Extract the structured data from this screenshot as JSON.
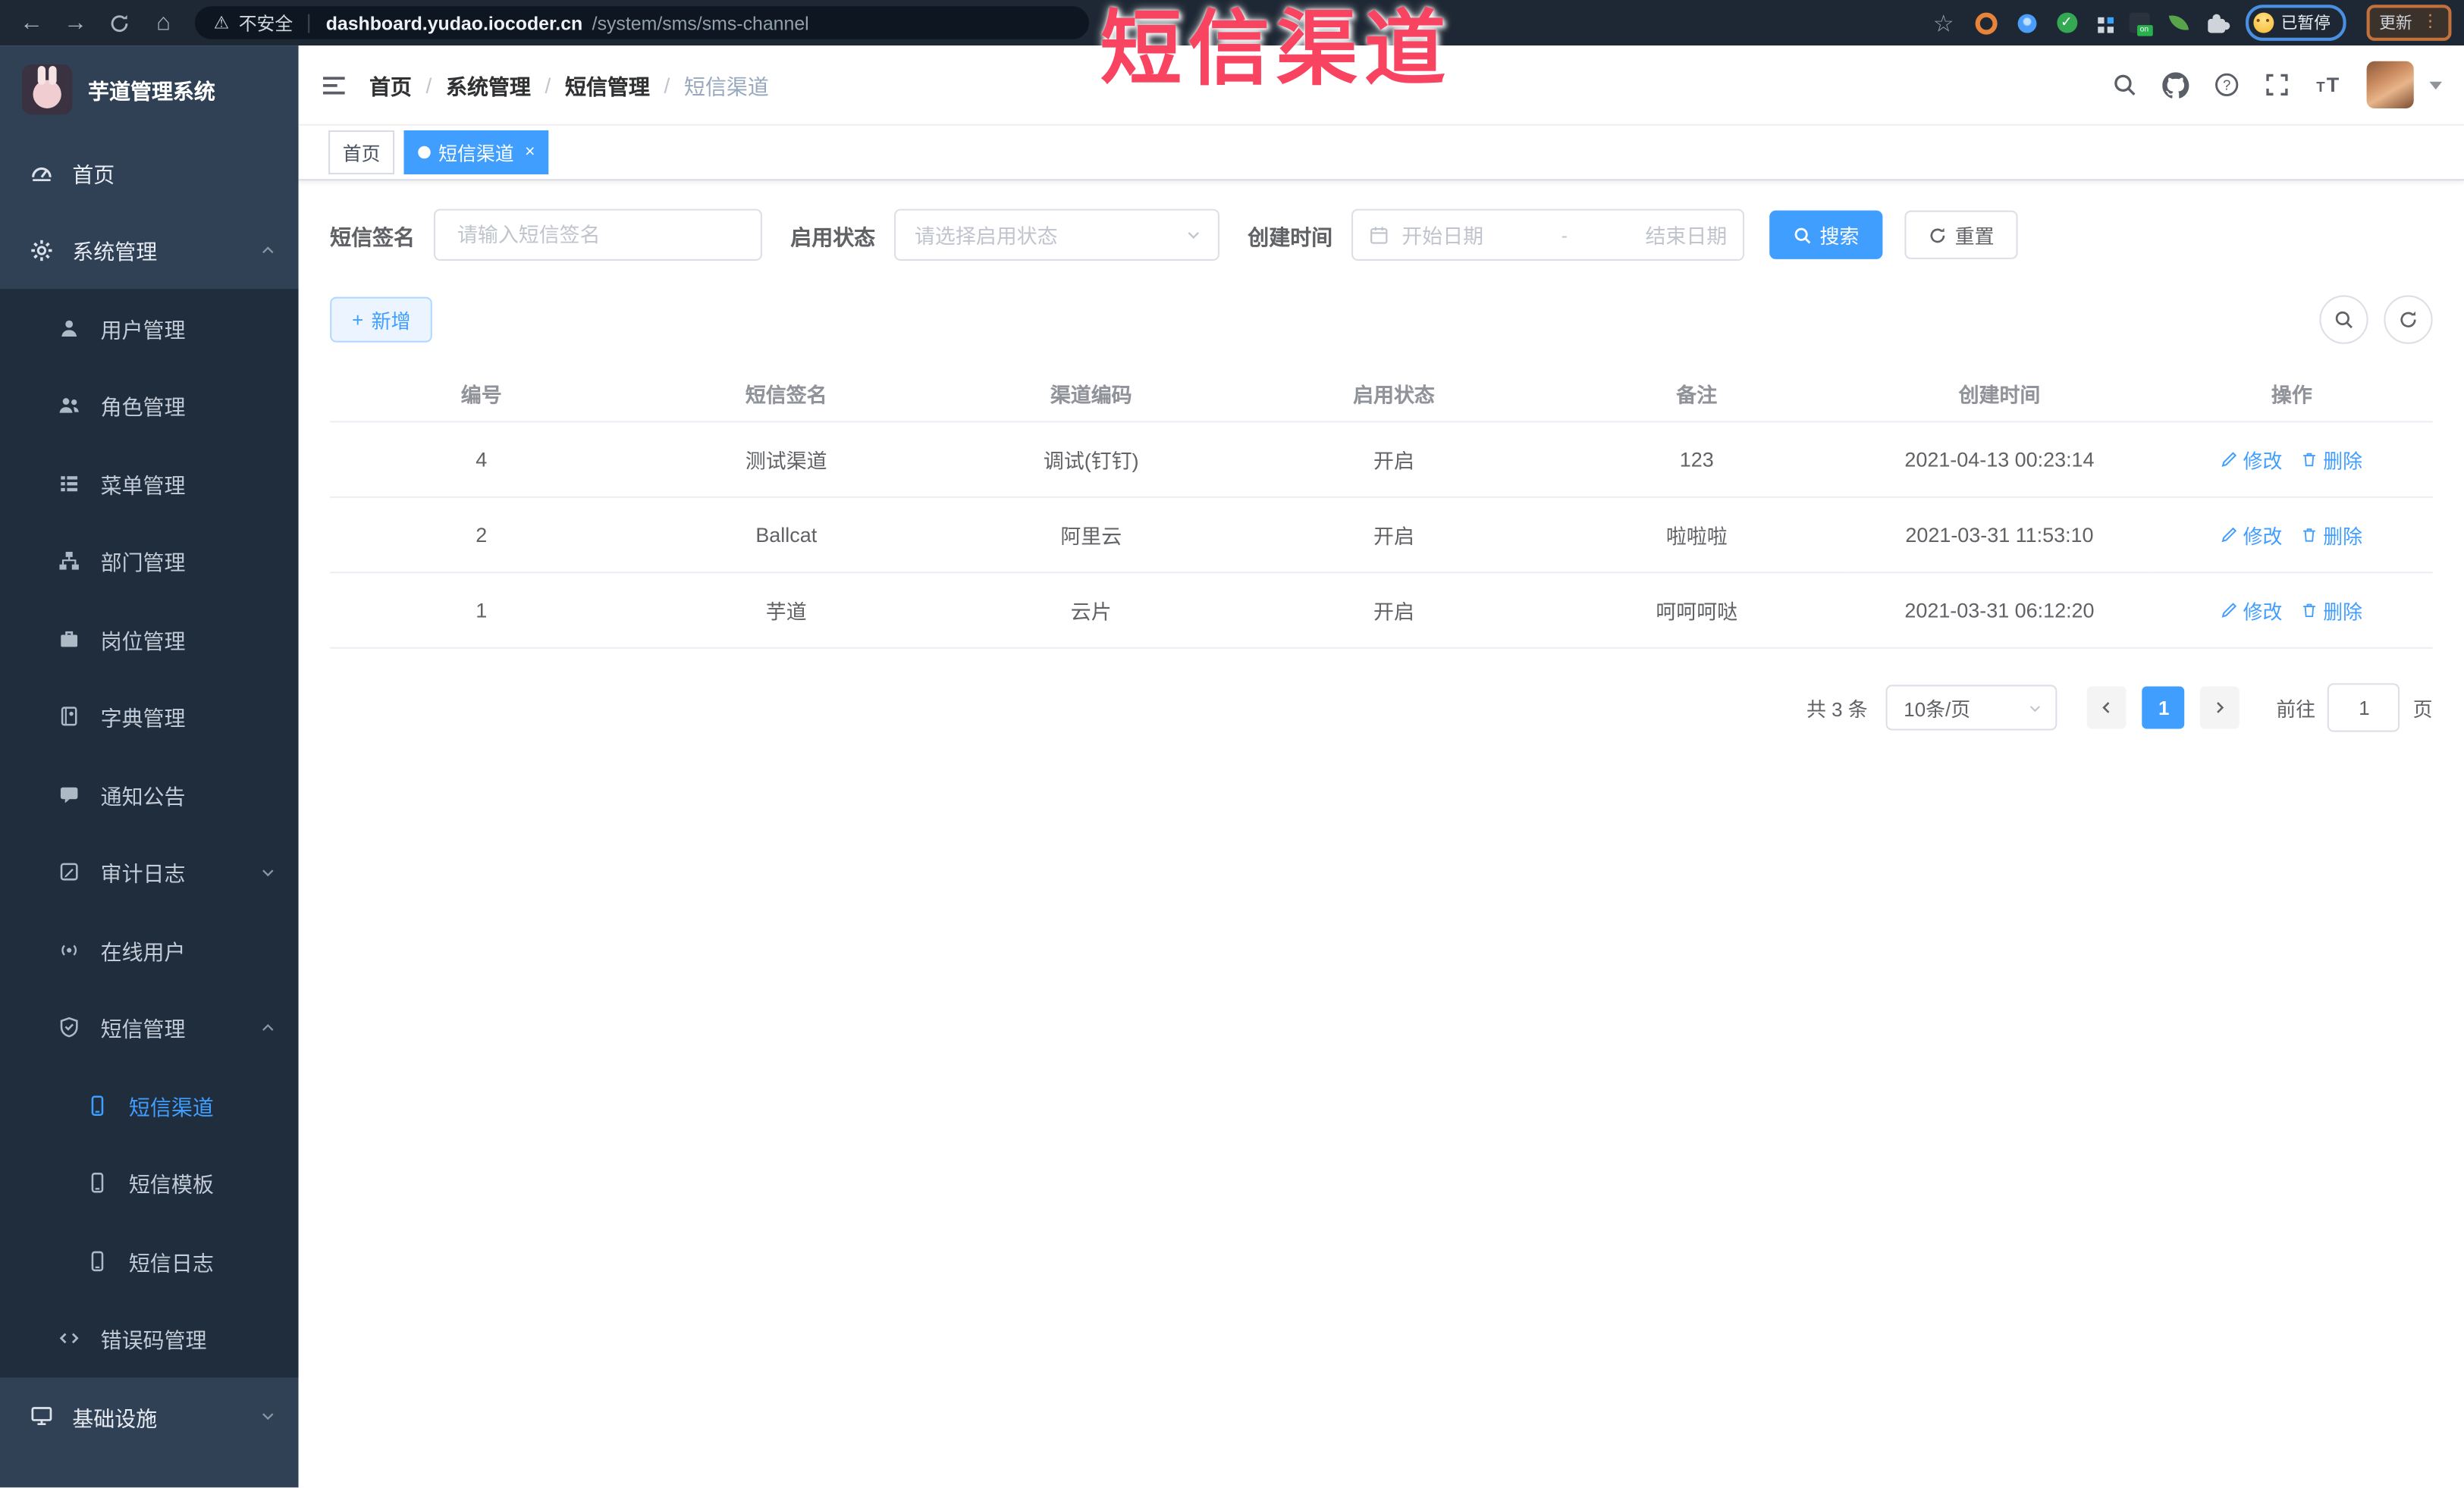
{
  "annotation": {
    "text": "短信渠道",
    "color": "#f84361"
  },
  "colors": {
    "primary": "#409eff",
    "sidebar_bg": "#304156",
    "submenu_bg": "#1f2d3d",
    "chrome_bg": "#1e2834"
  },
  "browser": {
    "security_label": "不安全",
    "url_host": "dashboard.yudao.iocoder.cn",
    "url_path": "/system/sms/sms-channel",
    "paused_badge": "已暂停",
    "update_button": "更新",
    "on_badge": "on"
  },
  "sidebar": {
    "app_title": "芋道管理系统",
    "items": [
      {
        "label": "首页"
      },
      {
        "label": "系统管理"
      },
      {
        "label": "用户管理"
      },
      {
        "label": "角色管理"
      },
      {
        "label": "菜单管理"
      },
      {
        "label": "部门管理"
      },
      {
        "label": "岗位管理"
      },
      {
        "label": "字典管理"
      },
      {
        "label": "通知公告"
      },
      {
        "label": "审计日志"
      },
      {
        "label": "在线用户"
      },
      {
        "label": "短信管理"
      },
      {
        "label": "短信渠道"
      },
      {
        "label": "短信模板"
      },
      {
        "label": "短信日志"
      },
      {
        "label": "错误码管理"
      },
      {
        "label": "基础设施"
      }
    ]
  },
  "header": {
    "breadcrumb": [
      "首页",
      "系统管理",
      "短信管理",
      "短信渠道"
    ],
    "breadcrumb_separator": "/"
  },
  "tabs": [
    {
      "label": "首页"
    },
    {
      "label": "短信渠道"
    }
  ],
  "icons": {
    "close": "×",
    "plus": "+",
    "check": "✓",
    "back": "←",
    "forward": "→",
    "home": "⌂",
    "star": "☆",
    "warning": "⚠",
    "dots": "⋮",
    "divider": "|"
  },
  "filters": {
    "sign_label": "短信签名",
    "sign_placeholder": "请输入短信签名",
    "status_label": "启用状态",
    "status_placeholder": "请选择启用状态",
    "time_label": "创建时间",
    "date_start_placeholder": "开始日期",
    "date_separator": "-",
    "date_end_placeholder": "结束日期",
    "search_button": "搜索",
    "reset_button": "重置"
  },
  "toolbar": {
    "add_button": "新增"
  },
  "table": {
    "columns": [
      "编号",
      "短信签名",
      "渠道编码",
      "启用状态",
      "备注",
      "创建时间",
      "操作"
    ],
    "action_edit": "修改",
    "action_delete": "删除",
    "rows": [
      {
        "id": "4",
        "sign": "测试渠道",
        "code": "调试(钉钉)",
        "status": "开启",
        "remark": "123",
        "created": "2021-04-13 00:23:14"
      },
      {
        "id": "2",
        "sign": "Ballcat",
        "code": "阿里云",
        "status": "开启",
        "remark": "啦啦啦",
        "created": "2021-03-31 11:53:10"
      },
      {
        "id": "1",
        "sign": "芋道",
        "code": "云片",
        "status": "开启",
        "remark": "呵呵呵哒",
        "created": "2021-03-31 06:12:20"
      }
    ]
  },
  "pagination": {
    "total_text": "共 3 条",
    "page_size": "10条/页",
    "current_page": "1",
    "goto_label": "前往",
    "goto_value": "1",
    "page_unit": "页"
  }
}
